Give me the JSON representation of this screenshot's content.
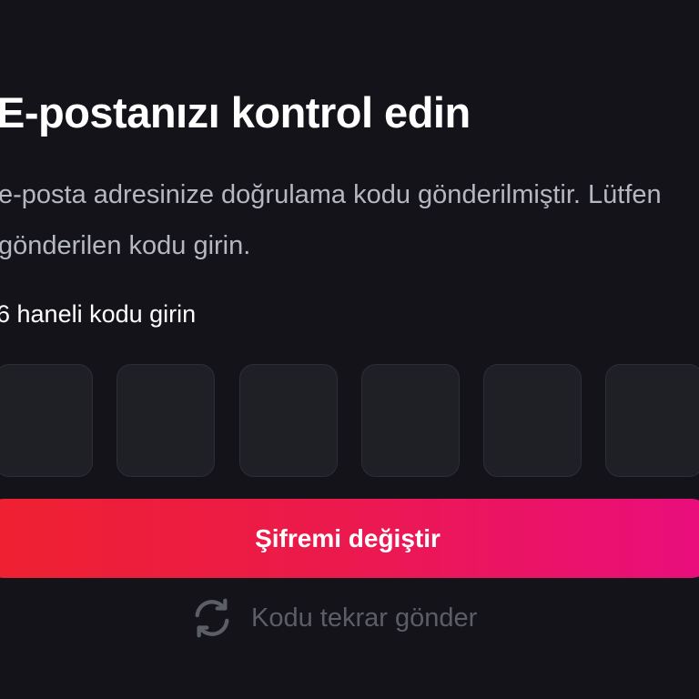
{
  "page": {
    "title": "E-postanızı kontrol edin",
    "description": "e-posta adresinize doğrulama kodu gönderilmiştir. Lütfen gönderilen kodu girin.",
    "code_label": "6 haneli kodu girin"
  },
  "code_inputs": [
    {
      "value": ""
    },
    {
      "value": ""
    },
    {
      "value": ""
    },
    {
      "value": ""
    },
    {
      "value": ""
    },
    {
      "value": ""
    }
  ],
  "submit_button": {
    "label": "Şifremi değiştir"
  },
  "resend": {
    "label": "Kodu tekrar gönder",
    "icon": "refresh-icon"
  },
  "colors": {
    "background": "#131319",
    "input_background": "#1f1f26",
    "gradient_start": "#ee2130",
    "gradient_end": "#e90e7d",
    "muted_text": "#5c5e67"
  }
}
